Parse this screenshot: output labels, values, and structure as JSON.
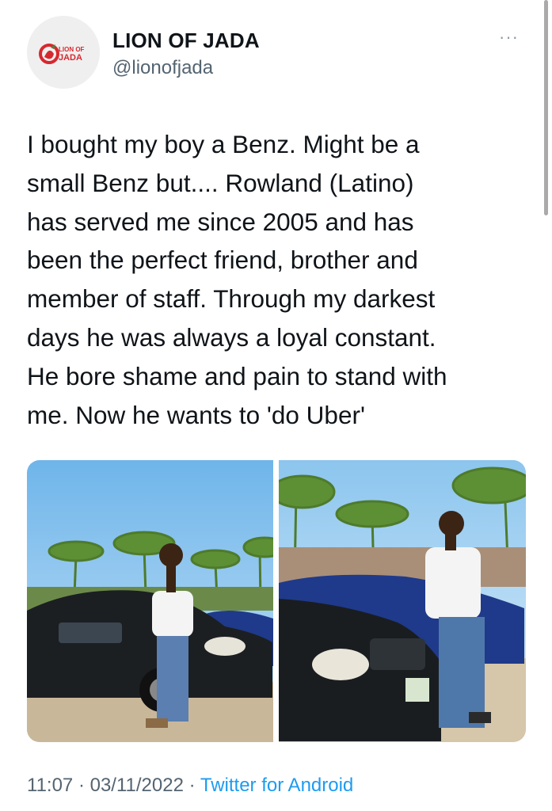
{
  "author": {
    "display_name": "LION OF JADA",
    "handle": "@lionofjada",
    "avatar_logo_text": [
      "LION OF",
      "JADA"
    ],
    "avatar_icon": "lion-logo-icon"
  },
  "menu": {
    "more_icon": "more-dots-icon",
    "glyph": "···"
  },
  "tweet": {
    "text": "I bought my boy a Benz. Might be a\nsmall Benz but.... Rowland (Latino)\nhas served me since 2005 and has\nbeen the perfect friend, brother and\nmember of staff. Through my darkest\ndays he was always a loyal constant.\nHe bore shame and pain to stand with\nme. Now he wants to 'do Uber'"
  },
  "media": {
    "count": 2,
    "photos": [
      "photo-1",
      "photo-2"
    ]
  },
  "meta": {
    "time": "11:07",
    "separator": " · ",
    "date": "03/11/2022",
    "client": "Twitter for Android"
  },
  "colors": {
    "text": "#0f1419",
    "secondary": "#536471",
    "link": "#1d9bf0",
    "logo_red": "#d7282f"
  }
}
